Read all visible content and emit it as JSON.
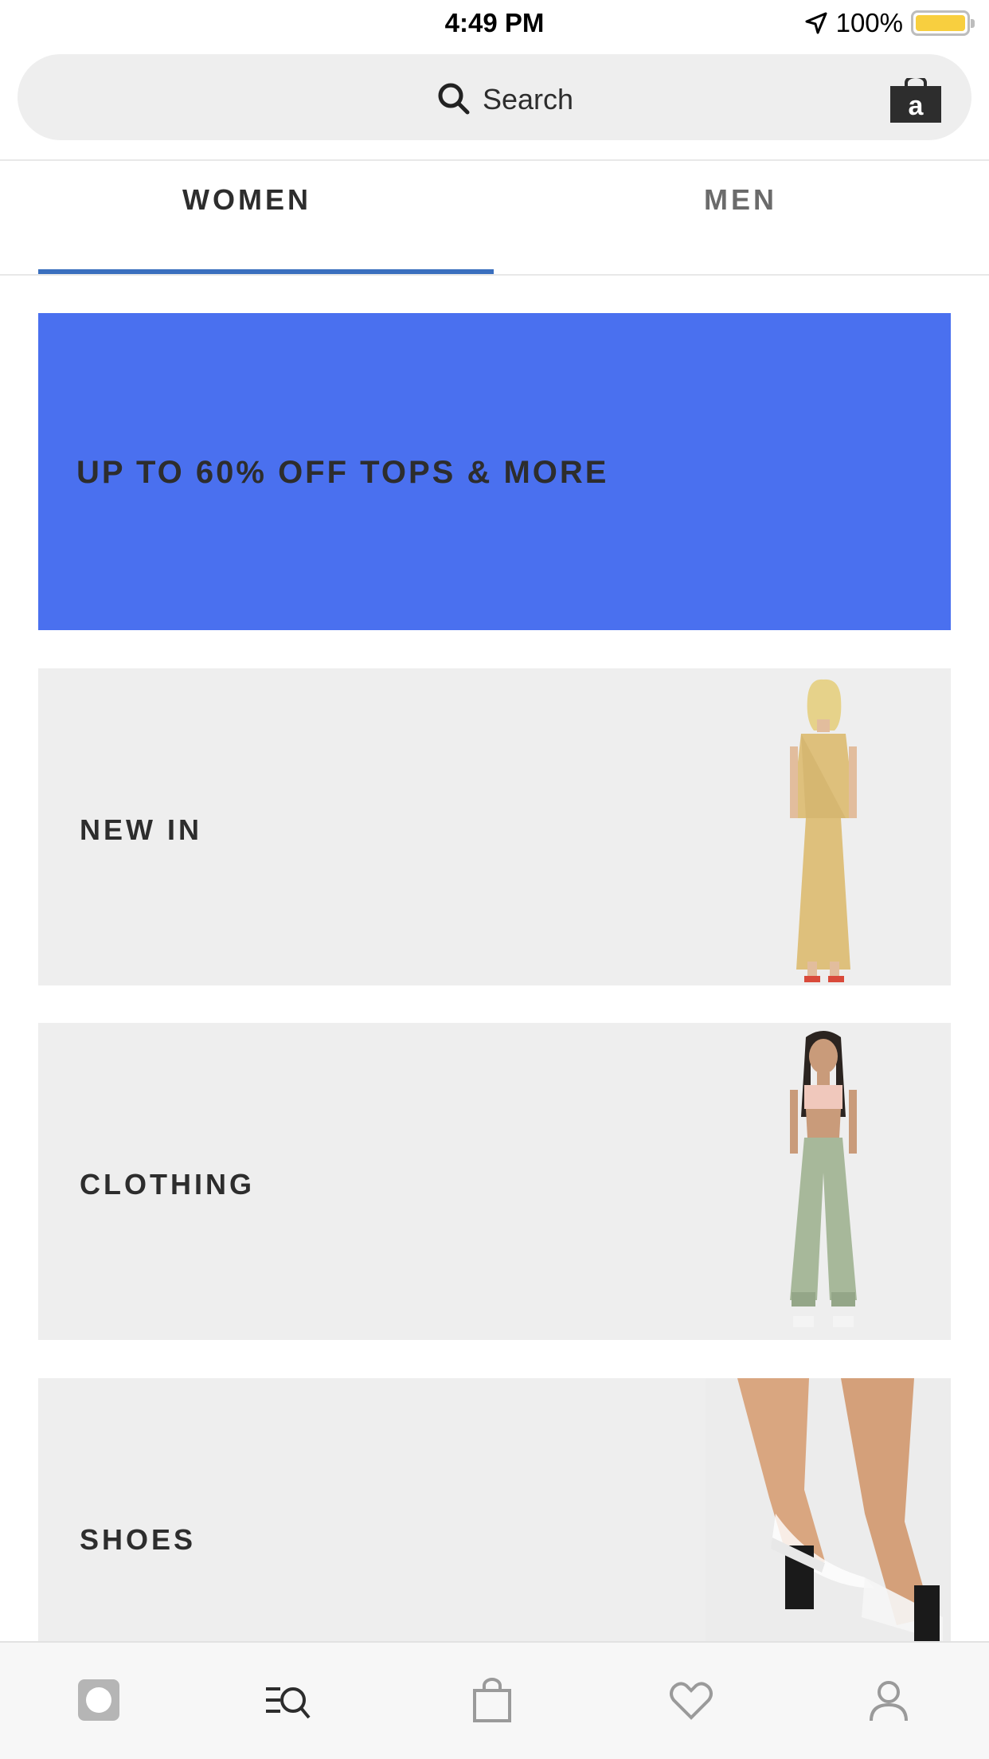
{
  "status_bar": {
    "time": "4:49 PM",
    "battery": "100%",
    "battery_level": 1.0,
    "icons": [
      "location-arrow-icon",
      "battery-icon"
    ]
  },
  "search": {
    "placeholder": "Search",
    "icon": "search-icon",
    "bag_icon": "bag-icon",
    "bag_letter": "a"
  },
  "tabs": [
    {
      "label": "WOMEN",
      "active": true
    },
    {
      "label": "MEN",
      "active": false
    }
  ],
  "promo": {
    "text": "UP TO 60% OFF TOPS & MORE",
    "background": "#4a70ef"
  },
  "categories": [
    {
      "label": "NEW IN",
      "image": "woman-wrap-dress-photo"
    },
    {
      "label": "CLOTHING",
      "image": "woman-cargo-trousers-photo"
    },
    {
      "label": "SHOES",
      "image": "clear-strap-block-heel-photo"
    }
  ],
  "bottom_nav": [
    {
      "name": "home-icon",
      "active": true
    },
    {
      "name": "search-categories-icon",
      "active": false
    },
    {
      "name": "bag-icon",
      "active": false
    },
    {
      "name": "saved-heart-icon",
      "active": false
    },
    {
      "name": "account-icon",
      "active": false
    }
  ],
  "colors": {
    "accent": "#3a6fbe",
    "promo_bg": "#4a70ef",
    "card_bg": "#eeeeee",
    "text": "#2d2d2d"
  }
}
